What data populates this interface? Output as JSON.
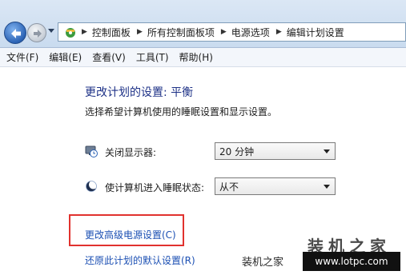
{
  "breadcrumbs": [
    "控制面板",
    "所有控制面板项",
    "电源选项",
    "编辑计划设置"
  ],
  "menu": [
    "文件(F)",
    "编辑(E)",
    "查看(V)",
    "工具(T)",
    "帮助(H)"
  ],
  "page": {
    "title": "更改计划的设置: 平衡",
    "description": "选择希望计算机使用的睡眠设置和显示设置。"
  },
  "settings": {
    "display_off": {
      "label": "关闭显示器:",
      "value": "20 分钟",
      "icon": "monitor-clock-icon"
    },
    "sleep": {
      "label": "使计算机进入睡眠状态:",
      "value": "从不",
      "icon": "moon-icon"
    }
  },
  "links": {
    "advanced": "更改高级电源设置(C)",
    "restore": "还原此计划的默认设置(R)"
  },
  "watermark": {
    "big": "装机之家",
    "small": "装机之家",
    "url": "www.lotpc.com"
  },
  "colors": {
    "title_blue": "#1e3287",
    "link_blue": "#1b4fb3",
    "highlight_red": "#e1322e"
  }
}
